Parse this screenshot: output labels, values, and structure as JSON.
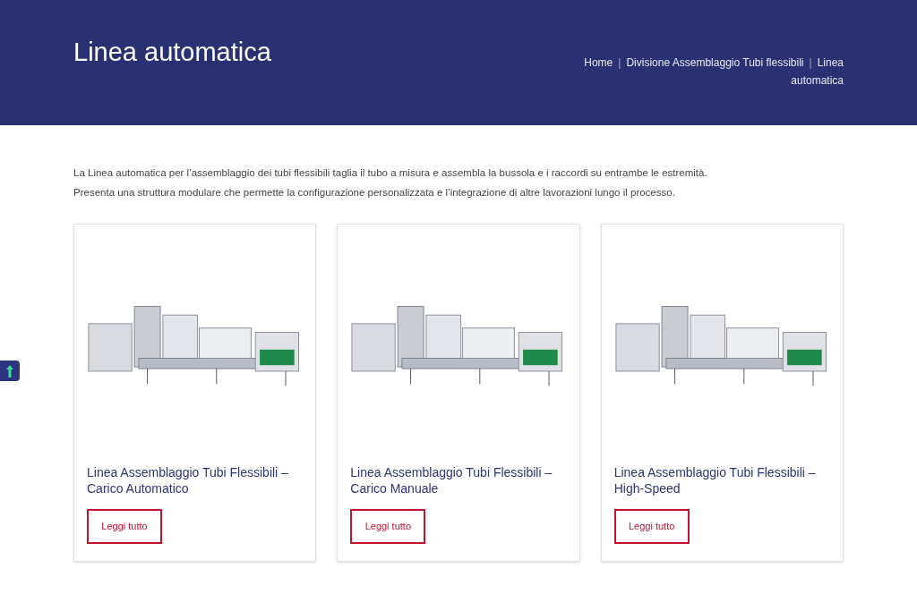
{
  "header": {
    "title": "Linea automatica",
    "breadcrumb": {
      "separator": "|",
      "items": [
        {
          "label": "Home"
        },
        {
          "label": "Divisione Assemblaggio Tubi flessibili"
        },
        {
          "label": "Linea automatica"
        }
      ]
    }
  },
  "intro": [
    "La Linea automatica per l’assemblaggio dei tubi flessibili taglia il tubo a misura e assembla la bussola e i raccordi su entrambe le estremità.",
    "Presenta una struttura modulare che permette la configurazione personalizzata e l’integrazione di altre lavorazioni lungo il processo."
  ],
  "cards": [
    {
      "title": "Linea Assemblaggio Tubi Flessibili – Carico Automatico",
      "button": "Leggi tutto"
    },
    {
      "title": "Linea Assemblaggio Tubi Flessibili – Carico Manuale",
      "button": "Leggi tutto"
    },
    {
      "title": "Linea Assemblaggio Tubi Flessibili – High-Speed",
      "button": "Leggi tutto"
    }
  ]
}
